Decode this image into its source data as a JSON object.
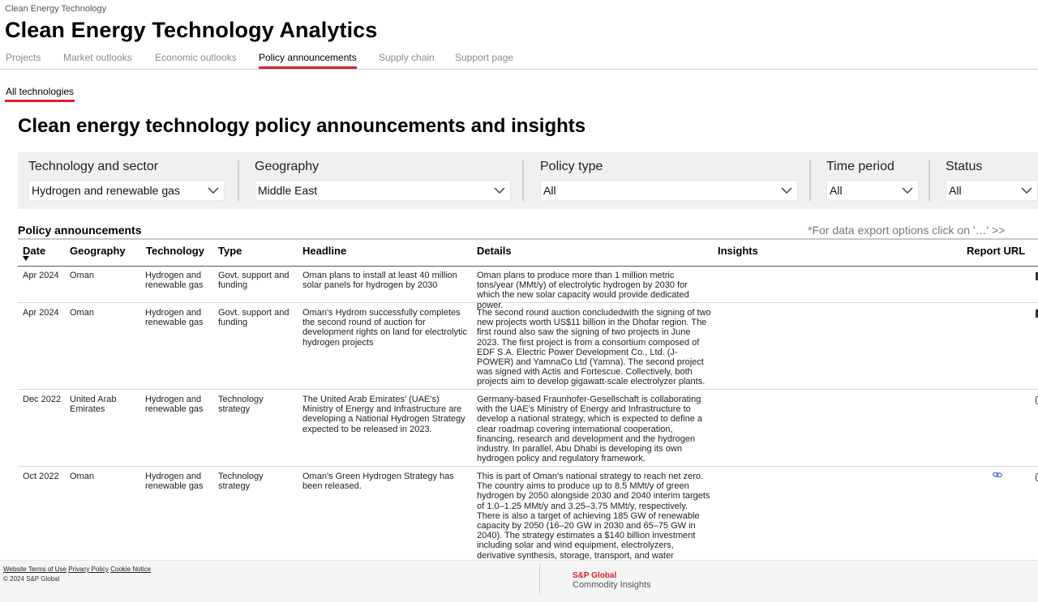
{
  "breadcrumb": "Clean Energy Technology",
  "app_title": "Clean Energy Technology Analytics",
  "tabs": [
    "Projects",
    "Market outlooks",
    "Economic outlooks",
    "Policy announcements",
    "Supply chain",
    "Support page"
  ],
  "active_tab": "Policy announcements",
  "subtab": "All technologies",
  "section_title": "Clean energy technology policy announcements and insights",
  "filters": [
    {
      "label": "Technology and sector",
      "value": "Hydrogen and renewable gas"
    },
    {
      "label": "Geography",
      "value": "Middle East"
    },
    {
      "label": "Policy type",
      "value": "All"
    },
    {
      "label": "Time period",
      "value": "All"
    },
    {
      "label": "Status",
      "value": "All"
    }
  ],
  "table_title": "Policy announcements",
  "export_note": "*For data export options click on '…' >>",
  "columns": [
    "Date",
    "Geography",
    "Technology",
    "Type",
    "Headline",
    "Details",
    "Insights",
    "Report URL"
  ],
  "sorted_column": "Date",
  "rows": [
    {
      "date": "Apr 2024",
      "geography": "Oman",
      "technology": "Hydrogen and renewable gas",
      "type": "Govt. support and funding",
      "headline": "Oman plans to install at least 40 million solar panels for hydrogen by 2030",
      "details": "Oman plans to produce more than 1 million metric tons/year (MMt/y) of electrolytic hydrogen by 2030 for which the new solar capacity would provide dedicated power.",
      "insights": "",
      "report_url": false
    },
    {
      "date": "Apr 2024",
      "geography": "Oman",
      "technology": "Hydrogen and renewable gas",
      "type": "Govt. support and funding",
      "headline": "Oman's Hydrom successfully completes the second round of auction for development rights on land for electrolytic hydrogen projects",
      "details": "The second round auction concludedwith the signing of two new projects worth US$11 billion in the Dhofar region. The first round also saw the signing of two projects in June 2023. The first project is from a consortium composed of EDF S.A. Electric Power Development Co., Ltd. (J-POWER) and YamnaCo Ltd (Yamna). The second project was signed with Actis and Fortescue. Collectively, both projects aim to develop gigawatt-scale electrolyzer plants.",
      "insights": "",
      "report_url": false
    },
    {
      "date": "Dec 2022",
      "geography": "United Arab Emirates",
      "technology": "Hydrogen and renewable gas",
      "type": "Technology strategy",
      "headline": "The United Arab Emirates' (UAE's) Ministry of Energy and Infrastructure are developing a National Hydrogen Strategy expected to be released in 2023.",
      "details": "Germany-based Fraunhofer-Gesellschaft is collaborating with the UAE's Ministry of Energy and Infrastructure to develop a national strategy, which is expected to define a clear roadmap covering international cooperation, financing, research and development and the hydrogen industry. In parallel, Abu Dhabi is developing its own hydrogen policy and regulatory framework.",
      "insights": "",
      "report_url": false
    },
    {
      "date": "Oct 2022",
      "geography": "Oman",
      "technology": "Hydrogen and renewable gas",
      "type": "Technology strategy",
      "headline": "Oman's Green Hydrogen Strategy has been released.",
      "details": "This is part of Oman's national strategy to reach net zero. The country aims to produce up to 8.5 MMt/y of green hydrogen by 2050 alongside 2030 and 2040 interim targets of 1.0–1.25 MMt/y and 3.25–3.75 MMt/y, respectively. There is also a target of achieving 185 GW of renewable capacity by 2050 (16–20 GW in 2030 and 65–75 GW in 2040). The strategy estimates a $140 billion investment including solar and wind equipment, electrolyzers, derivative synthesis, storage, transport, and water desalination.",
      "insights": "",
      "report_url": true
    }
  ],
  "footer": {
    "links": [
      "Website Terms of Use",
      "Privacy Policy",
      "Cookie Notice"
    ],
    "copyright": "© 2024 S&P Global",
    "brand": "S&P Global",
    "brand_sub": "Commodity Insights"
  },
  "colors": {
    "accent": "#d6232f",
    "filter_bg": "#f0f0f0",
    "muted_tab": "#8a8a8a",
    "link_icon": "#3b6fb6"
  },
  "icons": {
    "dropdown": "chevron-down-icon",
    "sort": "sort-desc-icon",
    "report_link": "link-icon"
  }
}
